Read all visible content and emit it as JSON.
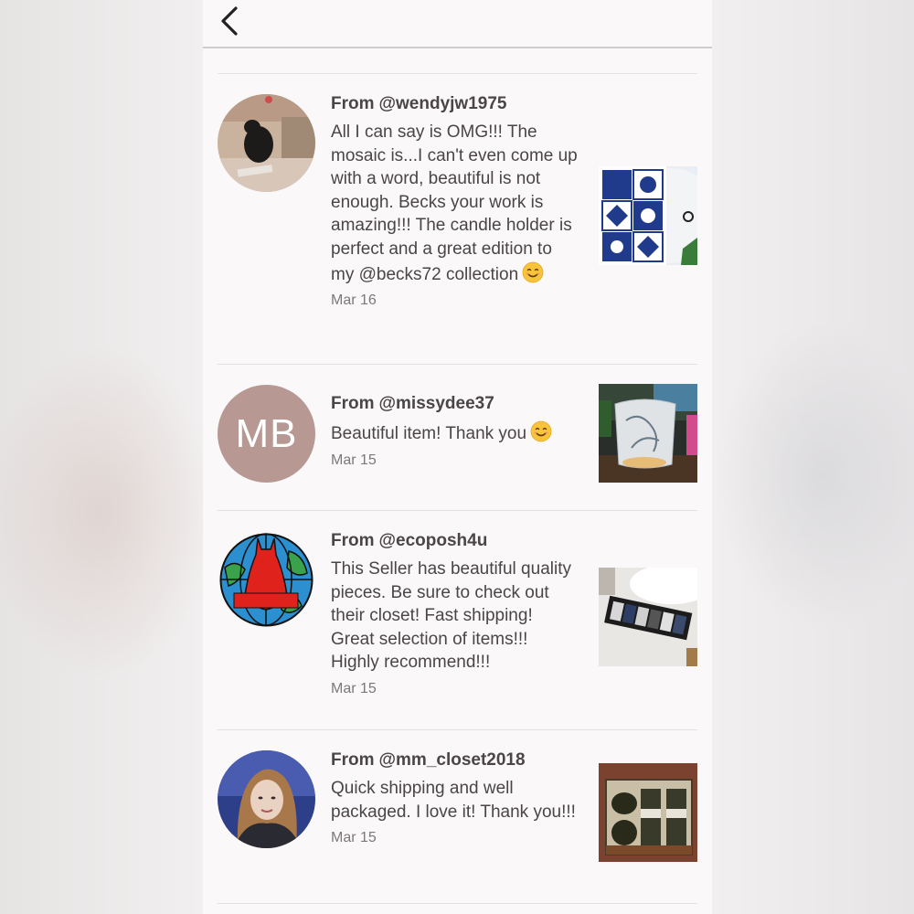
{
  "reviews": [
    {
      "from_label": "From",
      "username": "@wendyjw1975",
      "message": "All I can say is OMG!!! The mosaic is...I can't even come up with a word, beautiful is not enough. Becks your work is amazing!!! The candle holder is perfect and a great edition to my @becks72 collection",
      "emoji": "smiling-face-emoji",
      "date": "Mar 16"
    },
    {
      "from_label": "From",
      "username": "@missydee37",
      "message": "Beautiful item! Thank you",
      "emoji": "smiling-face-emoji",
      "avatar_initials": "MB",
      "date": "Mar 15"
    },
    {
      "from_label": "From",
      "username": "@ecoposh4u",
      "message": "This Seller has beautiful quality pieces. Be sure to check out their closet! Fast shipping! Great selection of items!!! Highly recommend!!!",
      "date": "Mar 15"
    },
    {
      "from_label": "From",
      "username": "@mm_closet2018",
      "message": "Quick shipping and well packaged. I love it! Thank you!!!",
      "date": "Mar 15"
    }
  ],
  "icons": {
    "back": "chevron-left-icon"
  },
  "colors": {
    "text": "#4a4546",
    "date": "#7d7879",
    "mb_avatar": "#b79893"
  }
}
